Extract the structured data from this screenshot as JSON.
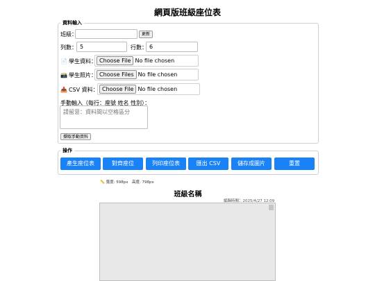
{
  "page_title": "網頁版班級座位表",
  "input_section": {
    "legend": "資料輸入",
    "class_label": "班級：",
    "class_value": "",
    "update_button": "更新",
    "cols_label": "列數：",
    "cols_value": "5",
    "rows_label": "行數：",
    "rows_value": "6",
    "student_data_label": "學生資料：",
    "student_photo_label": "學生照片：",
    "csv_label": "CSV 資料：",
    "choose_file": "Choose File",
    "choose_files": "Choose Files",
    "no_file": "No file chosen",
    "manual_label": "手動輸入（每行：座號 姓名 性別）：",
    "manual_placeholder": "請留意：資料間以空格區分",
    "read_manual_button": "擷取手動資料"
  },
  "actions_section": {
    "legend": "操作",
    "buttons": [
      "產生座位表",
      "對齊座位",
      "列印座位表",
      "匯出 CSV",
      "儲存成圖片",
      "重置"
    ]
  },
  "dimension_info": {
    "icon": "ruler-icon",
    "text": "寬度: 598px　高度: 798px"
  },
  "sheet": {
    "title": "班級名稱",
    "timestamp": "編輯時間：2025/4/27 12:09"
  },
  "colors": {
    "accent": "#1a82f7",
    "canvas_bg": "#e8e8e8"
  }
}
